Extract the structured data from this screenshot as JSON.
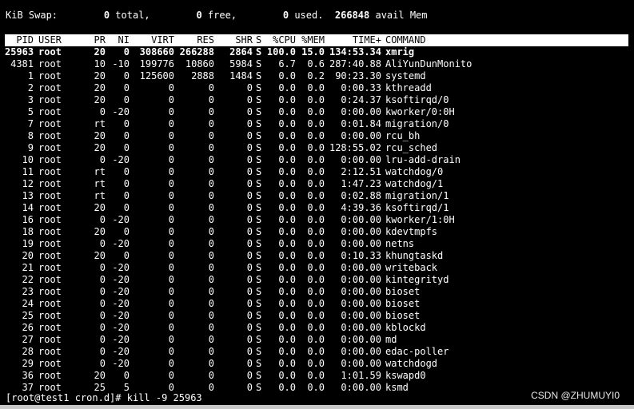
{
  "swap_line": {
    "label": "KiB Swap:",
    "total_value": "0",
    "total_label": "total,",
    "free_value": "0",
    "free_label": "free,",
    "used_value": "0",
    "used_label": "used.",
    "avail_value": "266848",
    "avail_label": "avail Mem"
  },
  "columns": {
    "pid": "PID",
    "user": "USER",
    "pr": "PR",
    "ni": "NI",
    "virt": "VIRT",
    "res": "RES",
    "shr": "SHR",
    "s": "S",
    "cpu": "%CPU",
    "mem": "%MEM",
    "time": "TIME+",
    "command": "COMMAND"
  },
  "processes": [
    {
      "pid": "25963",
      "user": "root",
      "pr": "20",
      "ni": "0",
      "virt": "308660",
      "res": "266288",
      "shr": "2864",
      "s": "S",
      "cpu": "100.0",
      "mem": "15.0",
      "time": "134:53.34",
      "command": "xmrig"
    },
    {
      "pid": "4381",
      "user": "root",
      "pr": "10",
      "ni": "-10",
      "virt": "199776",
      "res": "10860",
      "shr": "5984",
      "s": "S",
      "cpu": "6.7",
      "mem": "0.6",
      "time": "287:40.88",
      "command": "AliYunDunMonito"
    },
    {
      "pid": "1",
      "user": "root",
      "pr": "20",
      "ni": "0",
      "virt": "125600",
      "res": "2888",
      "shr": "1484",
      "s": "S",
      "cpu": "0.0",
      "mem": "0.2",
      "time": "90:23.30",
      "command": "systemd"
    },
    {
      "pid": "2",
      "user": "root",
      "pr": "20",
      "ni": "0",
      "virt": "0",
      "res": "0",
      "shr": "0",
      "s": "S",
      "cpu": "0.0",
      "mem": "0.0",
      "time": "0:00.33",
      "command": "kthreadd"
    },
    {
      "pid": "3",
      "user": "root",
      "pr": "20",
      "ni": "0",
      "virt": "0",
      "res": "0",
      "shr": "0",
      "s": "S",
      "cpu": "0.0",
      "mem": "0.0",
      "time": "0:24.37",
      "command": "ksoftirqd/0"
    },
    {
      "pid": "5",
      "user": "root",
      "pr": "0",
      "ni": "-20",
      "virt": "0",
      "res": "0",
      "shr": "0",
      "s": "S",
      "cpu": "0.0",
      "mem": "0.0",
      "time": "0:00.00",
      "command": "kworker/0:0H"
    },
    {
      "pid": "7",
      "user": "root",
      "pr": "rt",
      "ni": "0",
      "virt": "0",
      "res": "0",
      "shr": "0",
      "s": "S",
      "cpu": "0.0",
      "mem": "0.0",
      "time": "0:01.84",
      "command": "migration/0"
    },
    {
      "pid": "8",
      "user": "root",
      "pr": "20",
      "ni": "0",
      "virt": "0",
      "res": "0",
      "shr": "0",
      "s": "S",
      "cpu": "0.0",
      "mem": "0.0",
      "time": "0:00.00",
      "command": "rcu_bh"
    },
    {
      "pid": "9",
      "user": "root",
      "pr": "20",
      "ni": "0",
      "virt": "0",
      "res": "0",
      "shr": "0",
      "s": "S",
      "cpu": "0.0",
      "mem": "0.0",
      "time": "128:55.02",
      "command": "rcu_sched"
    },
    {
      "pid": "10",
      "user": "root",
      "pr": "0",
      "ni": "-20",
      "virt": "0",
      "res": "0",
      "shr": "0",
      "s": "S",
      "cpu": "0.0",
      "mem": "0.0",
      "time": "0:00.00",
      "command": "lru-add-drain"
    },
    {
      "pid": "11",
      "user": "root",
      "pr": "rt",
      "ni": "0",
      "virt": "0",
      "res": "0",
      "shr": "0",
      "s": "S",
      "cpu": "0.0",
      "mem": "0.0",
      "time": "2:12.51",
      "command": "watchdog/0"
    },
    {
      "pid": "12",
      "user": "root",
      "pr": "rt",
      "ni": "0",
      "virt": "0",
      "res": "0",
      "shr": "0",
      "s": "S",
      "cpu": "0.0",
      "mem": "0.0",
      "time": "1:47.23",
      "command": "watchdog/1"
    },
    {
      "pid": "13",
      "user": "root",
      "pr": "rt",
      "ni": "0",
      "virt": "0",
      "res": "0",
      "shr": "0",
      "s": "S",
      "cpu": "0.0",
      "mem": "0.0",
      "time": "0:02.88",
      "command": "migration/1"
    },
    {
      "pid": "14",
      "user": "root",
      "pr": "20",
      "ni": "0",
      "virt": "0",
      "res": "0",
      "shr": "0",
      "s": "S",
      "cpu": "0.0",
      "mem": "0.0",
      "time": "4:39.36",
      "command": "ksoftirqd/1"
    },
    {
      "pid": "16",
      "user": "root",
      "pr": "0",
      "ni": "-20",
      "virt": "0",
      "res": "0",
      "shr": "0",
      "s": "S",
      "cpu": "0.0",
      "mem": "0.0",
      "time": "0:00.00",
      "command": "kworker/1:0H"
    },
    {
      "pid": "18",
      "user": "root",
      "pr": "20",
      "ni": "0",
      "virt": "0",
      "res": "0",
      "shr": "0",
      "s": "S",
      "cpu": "0.0",
      "mem": "0.0",
      "time": "0:00.00",
      "command": "kdevtmpfs"
    },
    {
      "pid": "19",
      "user": "root",
      "pr": "0",
      "ni": "-20",
      "virt": "0",
      "res": "0",
      "shr": "0",
      "s": "S",
      "cpu": "0.0",
      "mem": "0.0",
      "time": "0:00.00",
      "command": "netns"
    },
    {
      "pid": "20",
      "user": "root",
      "pr": "20",
      "ni": "0",
      "virt": "0",
      "res": "0",
      "shr": "0",
      "s": "S",
      "cpu": "0.0",
      "mem": "0.0",
      "time": "0:10.33",
      "command": "khungtaskd"
    },
    {
      "pid": "21",
      "user": "root",
      "pr": "0",
      "ni": "-20",
      "virt": "0",
      "res": "0",
      "shr": "0",
      "s": "S",
      "cpu": "0.0",
      "mem": "0.0",
      "time": "0:00.00",
      "command": "writeback"
    },
    {
      "pid": "22",
      "user": "root",
      "pr": "0",
      "ni": "-20",
      "virt": "0",
      "res": "0",
      "shr": "0",
      "s": "S",
      "cpu": "0.0",
      "mem": "0.0",
      "time": "0:00.00",
      "command": "kintegrityd"
    },
    {
      "pid": "23",
      "user": "root",
      "pr": "0",
      "ni": "-20",
      "virt": "0",
      "res": "0",
      "shr": "0",
      "s": "S",
      "cpu": "0.0",
      "mem": "0.0",
      "time": "0:00.00",
      "command": "bioset"
    },
    {
      "pid": "24",
      "user": "root",
      "pr": "0",
      "ni": "-20",
      "virt": "0",
      "res": "0",
      "shr": "0",
      "s": "S",
      "cpu": "0.0",
      "mem": "0.0",
      "time": "0:00.00",
      "command": "bioset"
    },
    {
      "pid": "25",
      "user": "root",
      "pr": "0",
      "ni": "-20",
      "virt": "0",
      "res": "0",
      "shr": "0",
      "s": "S",
      "cpu": "0.0",
      "mem": "0.0",
      "time": "0:00.00",
      "command": "bioset"
    },
    {
      "pid": "26",
      "user": "root",
      "pr": "0",
      "ni": "-20",
      "virt": "0",
      "res": "0",
      "shr": "0",
      "s": "S",
      "cpu": "0.0",
      "mem": "0.0",
      "time": "0:00.00",
      "command": "kblockd"
    },
    {
      "pid": "27",
      "user": "root",
      "pr": "0",
      "ni": "-20",
      "virt": "0",
      "res": "0",
      "shr": "0",
      "s": "S",
      "cpu": "0.0",
      "mem": "0.0",
      "time": "0:00.00",
      "command": "md"
    },
    {
      "pid": "28",
      "user": "root",
      "pr": "0",
      "ni": "-20",
      "virt": "0",
      "res": "0",
      "shr": "0",
      "s": "S",
      "cpu": "0.0",
      "mem": "0.0",
      "time": "0:00.00",
      "command": "edac-poller"
    },
    {
      "pid": "29",
      "user": "root",
      "pr": "0",
      "ni": "-20",
      "virt": "0",
      "res": "0",
      "shr": "0",
      "s": "S",
      "cpu": "0.0",
      "mem": "0.0",
      "time": "0:00.00",
      "command": "watchdogd"
    },
    {
      "pid": "36",
      "user": "root",
      "pr": "20",
      "ni": "0",
      "virt": "0",
      "res": "0",
      "shr": "0",
      "s": "S",
      "cpu": "0.0",
      "mem": "0.0",
      "time": "1:01.59",
      "command": "kswapd0"
    },
    {
      "pid": "37",
      "user": "root",
      "pr": "25",
      "ni": "5",
      "virt": "0",
      "res": "0",
      "shr": "0",
      "s": "S",
      "cpu": "0.0",
      "mem": "0.0",
      "time": "0:00.00",
      "command": "ksmd"
    }
  ],
  "prompt": {
    "text": "[root@test1 cron.d]# kill -9 25963"
  },
  "watermark": "CSDN @ZHUMUYI0",
  "colors": {
    "background": "#000000",
    "foreground": "#ffffff",
    "header_bar": "#ffffff",
    "header_text": "#000000"
  }
}
